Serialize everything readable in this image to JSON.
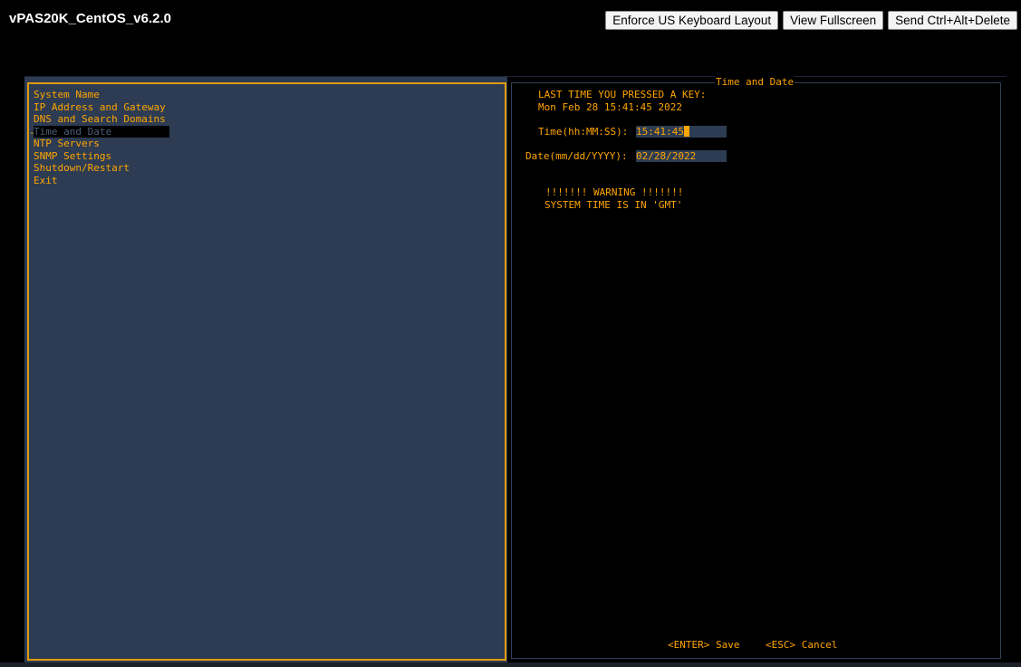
{
  "window": {
    "title": "vPAS20K_CentOS_v6.2.0"
  },
  "toolbar": {
    "enforce_keyboard_label": "Enforce US Keyboard Layout",
    "fullscreen_label": "View Fullscreen",
    "ctrl_alt_del_label": "Send Ctrl+Alt+Delete"
  },
  "menu": {
    "items": [
      {
        "label": "System Name"
      },
      {
        "label": "IP Address and Gateway"
      },
      {
        "label": "DNS and Search Domains"
      },
      {
        "label": "Time and Date"
      },
      {
        "label": "NTP Servers"
      },
      {
        "label": "SNMP Settings"
      },
      {
        "label": "Shutdown/Restart"
      },
      {
        "label": "Exit"
      }
    ],
    "selected_marker": "-"
  },
  "panel": {
    "title": "Time and Date",
    "last_key_label": "LAST TIME YOU PRESSED A KEY:",
    "last_key_value": "Mon Feb 28 15:41:45 2022",
    "time_label": "Time(hh:MM:SS):",
    "time_value": "15:41:45",
    "date_label": "Date(mm/dd/YYYY):",
    "date_value": "02/28/2022",
    "warning_line1": "!!!!!!! WARNING !!!!!!!",
    "warning_line2": "SYSTEM TIME IS IN 'GMT'",
    "save_hint": "<ENTER> Save",
    "cancel_hint": "<ESC> Cancel"
  },
  "colors": {
    "terminal_text": "#ffa500",
    "left_pane_bg": "#2d3c52",
    "frame_border": "#e09a10"
  }
}
